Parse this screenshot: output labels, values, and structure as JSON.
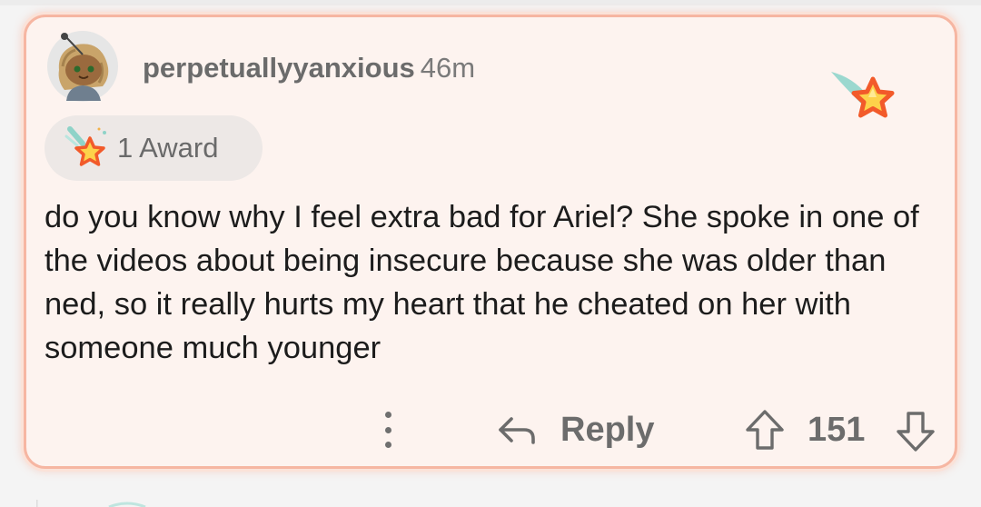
{
  "comment": {
    "author": "perpetuallyyanxious",
    "time_ago": "46m",
    "awards_label": "1 Award",
    "body": "do you know why I feel extra bad for Ariel? She spoke in one of the videos about being insecure because she was older than ned, so it really hurts my heart that he cheated on her with someone much younger",
    "reply_label": "Reply",
    "vote_count": "151"
  },
  "icons": {
    "avatar": "snoo-avatar-icon",
    "award": "shooting-star-award-icon",
    "more": "more-options-icon",
    "reply": "reply-arrow-icon",
    "upvote": "upvote-arrow-icon",
    "downvote": "downvote-arrow-icon"
  },
  "colors": {
    "card_background": "#fdf3ef",
    "card_border": "#f6b6a2",
    "pill_background": "#ede8e6",
    "star_fill": "#fdd24a",
    "star_stroke": "#f25a2a",
    "body_text": "#1c1c1c",
    "meta_text": "#6c6c6c"
  }
}
